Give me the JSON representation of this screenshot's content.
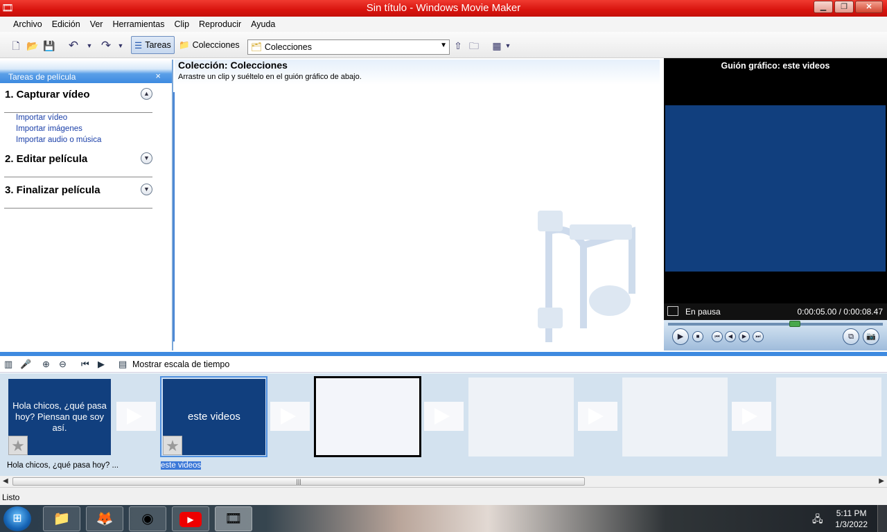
{
  "window": {
    "title": "Sin título - Windows Movie Maker"
  },
  "menu": [
    "Archivo",
    "Edición",
    "Ver",
    "Herramientas",
    "Clip",
    "Reproducir",
    "Ayuda"
  ],
  "toolbar": {
    "tasks_label": "Tareas",
    "collections_label": "Colecciones",
    "combo_value": "Colecciones"
  },
  "tasks_pane": {
    "header": "Tareas de película",
    "sections": [
      {
        "title": "1. Capturar vídeo",
        "links": [
          "Importar vídeo",
          "Importar imágenes",
          "Importar audio o música"
        ]
      },
      {
        "title": "2. Editar película"
      },
      {
        "title": "3. Finalizar película"
      }
    ]
  },
  "collection": {
    "title": "Colección: Colecciones",
    "subtitle": "Arrastre un clip y suéltelo en el guión gráfico de abajo."
  },
  "player": {
    "title": "Guión gráfico: este videos",
    "status": "En pausa",
    "time": "0:00:05.00 / 0:00:08.47",
    "progress": 0.59
  },
  "storyboard": {
    "show_timeline_label": "Mostrar escala de tiempo",
    "clips": [
      {
        "text": "Hola chicos, ¿qué pasa hoy? Piensan que soy así.",
        "caption": "Hola chicos, ¿qué pasa hoy? ..."
      },
      {
        "text": "este videos",
        "caption": "este videos"
      }
    ]
  },
  "status_bar": {
    "text": "Listo"
  },
  "taskbar": {
    "time": "5:11 PM",
    "date": "1/3/2022"
  },
  "colors": {
    "title_red": "#d8140e",
    "accent_blue": "#3e8ae0",
    "clip_blue": "#113f7e"
  }
}
